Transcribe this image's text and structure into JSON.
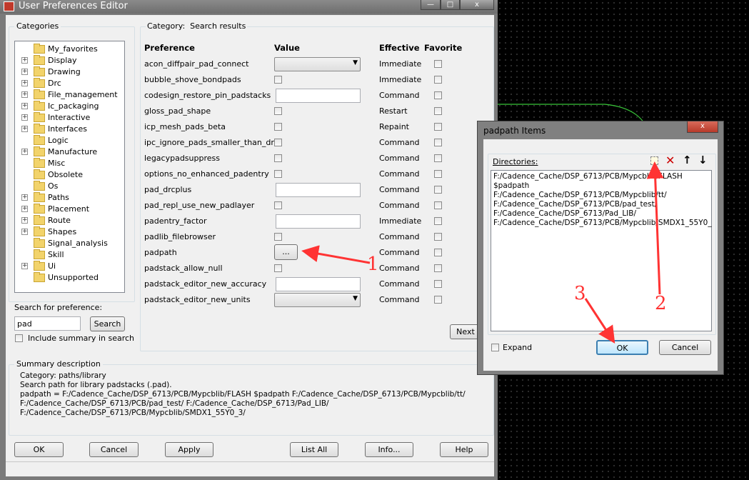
{
  "main_window": {
    "title": "User Preferences Editor",
    "minimize": "—",
    "maximize": "□",
    "close": "x"
  },
  "categories": {
    "label": "Categories",
    "items": [
      {
        "label": "My_favorites",
        "expandable": false
      },
      {
        "label": "Display",
        "expandable": true
      },
      {
        "label": "Drawing",
        "expandable": true
      },
      {
        "label": "Drc",
        "expandable": true
      },
      {
        "label": "File_management",
        "expandable": true
      },
      {
        "label": "Ic_packaging",
        "expandable": true
      },
      {
        "label": "Interactive",
        "expandable": true
      },
      {
        "label": "Interfaces",
        "expandable": true
      },
      {
        "label": "Logic",
        "expandable": false
      },
      {
        "label": "Manufacture",
        "expandable": true
      },
      {
        "label": "Misc",
        "expandable": false
      },
      {
        "label": "Obsolete",
        "expandable": false
      },
      {
        "label": "Os",
        "expandable": false
      },
      {
        "label": "Paths",
        "expandable": true
      },
      {
        "label": "Placement",
        "expandable": true
      },
      {
        "label": "Route",
        "expandable": true
      },
      {
        "label": "Shapes",
        "expandable": true
      },
      {
        "label": "Signal_analysis",
        "expandable": false
      },
      {
        "label": "Skill",
        "expandable": false
      },
      {
        "label": "Ui",
        "expandable": true
      },
      {
        "label": "Unsupported",
        "expandable": false
      }
    ]
  },
  "search": {
    "label": "Search for preference:",
    "value": "pad",
    "button": "Search",
    "include_summary": "Include summary in search"
  },
  "results": {
    "category_label": "Category:",
    "category_value": "Search results",
    "headers": {
      "preference": "Preference",
      "value": "Value",
      "effective": "Effective",
      "favorite": "Favorite"
    },
    "rows": [
      {
        "name": "acon_diffpair_pad_connect",
        "control": "combo",
        "effective": "Immediate"
      },
      {
        "name": "bubble_shove_bondpads",
        "control": "checkbox",
        "effective": "Immediate"
      },
      {
        "name": "codesign_restore_pin_padstacks",
        "control": "text",
        "effective": "Command"
      },
      {
        "name": "gloss_pad_shape",
        "control": "checkbox",
        "effective": "Restart"
      },
      {
        "name": "icp_mesh_pads_beta",
        "control": "checkbox",
        "effective": "Repaint"
      },
      {
        "name": "ipc_ignore_pads_smaller_than_drill",
        "control": "checkbox",
        "effective": "Command"
      },
      {
        "name": "legacypadsuppress",
        "control": "checkbox",
        "effective": "Command"
      },
      {
        "name": "options_no_enhanced_padentry",
        "control": "checkbox",
        "effective": "Command"
      },
      {
        "name": "pad_drcplus",
        "control": "text",
        "effective": "Command"
      },
      {
        "name": "pad_repl_use_new_padlayer",
        "control": "checkbox",
        "effective": "Command"
      },
      {
        "name": "padentry_factor",
        "control": "text",
        "effective": "Immediate"
      },
      {
        "name": "padlib_filebrowser",
        "control": "checkbox",
        "effective": "Command"
      },
      {
        "name": "padpath",
        "control": "browse",
        "effective": "Command"
      },
      {
        "name": "padstack_allow_null",
        "control": "checkbox",
        "effective": "Command"
      },
      {
        "name": "padstack_editor_new_accuracy",
        "control": "text",
        "effective": "Command"
      },
      {
        "name": "padstack_editor_new_units",
        "control": "combo",
        "effective": "Command"
      }
    ],
    "browse_label": "...",
    "next_button": "Next"
  },
  "summary": {
    "label": "Summary description",
    "lines": [
      "Category: paths/library",
      "Search path for library padstacks (.pad).",
      "padpath = F:/Cadence_Cache/DSP_6713/PCB/Mypcblib/FLASH $padpath F:/Cadence_Cache/DSP_6713/PCB/Mypcblib/tt/",
      "F:/Cadence_Cache/DSP_6713/PCB/pad_test/ F:/Cadence_Cache/DSP_6713/Pad_LIB/",
      "F:/Cadence_Cache/DSP_6713/PCB/Mypcblib/SMDX1_55Y0_3/"
    ]
  },
  "footer_buttons": {
    "ok": "OK",
    "cancel": "Cancel",
    "apply": "Apply",
    "list_all": "List All",
    "info": "Info...",
    "help": "Help"
  },
  "pad_dialog": {
    "title": "padpath Items",
    "close": "x",
    "directories_label": "Directories:",
    "directories": [
      "F:/Cadence_Cache/DSP_6713/PCB/Mypcblib/FLASH",
      "$padpath",
      "F:/Cadence_Cache/DSP_6713/PCB/Mypcblib/tt/",
      "F:/Cadence_Cache/DSP_6713/PCB/pad_test/",
      "F:/Cadence_Cache/DSP_6713/Pad_LIB/",
      "F:/Cadence_Cache/DSP_6713/PCB/Mypcblib/SMDX1_55Y0_"
    ],
    "expand_label": "Expand",
    "ok": "OK",
    "cancel": "Cancel"
  },
  "annotations": {
    "one": "1",
    "two": "2",
    "three": "3",
    "color": "#ff3333"
  }
}
